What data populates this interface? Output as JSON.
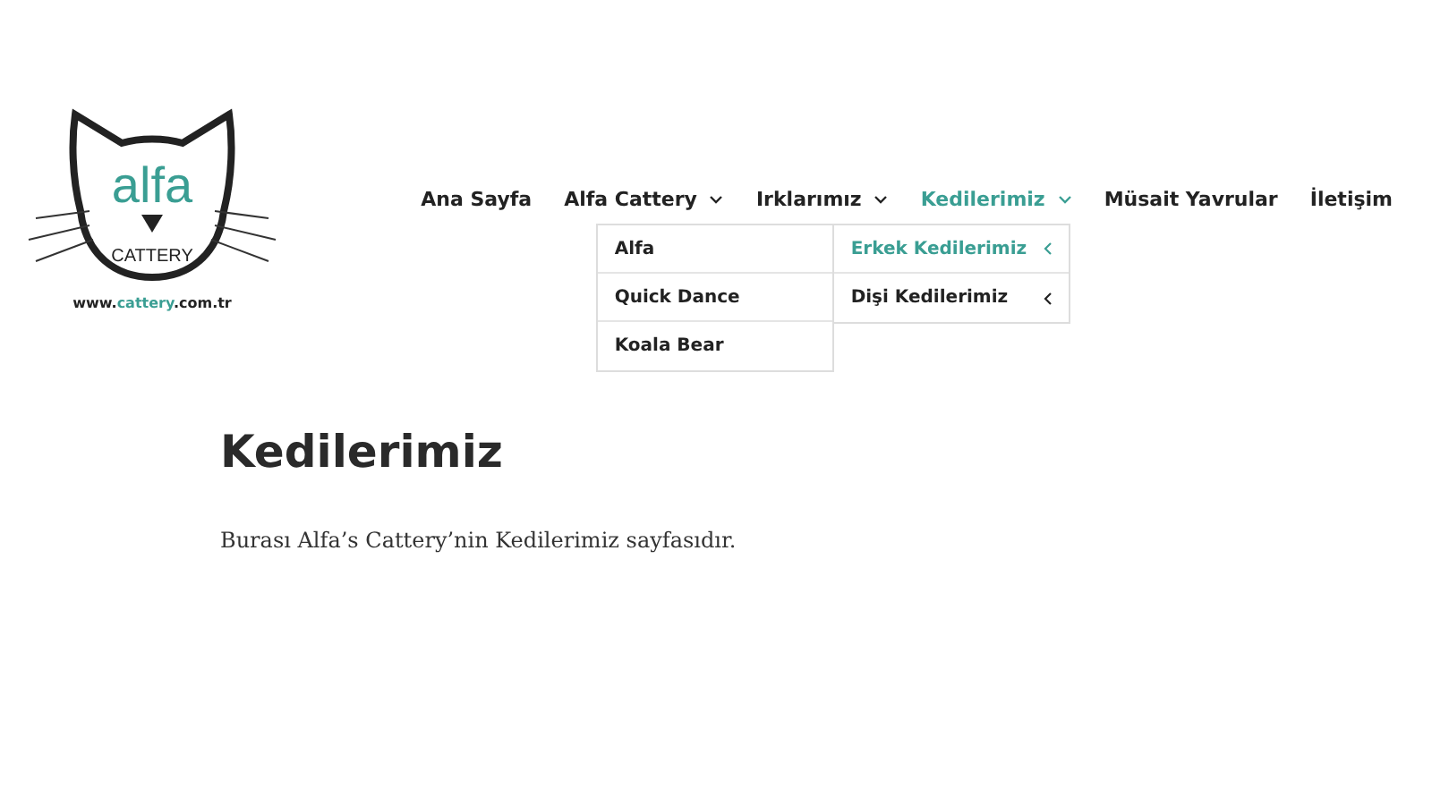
{
  "logo": {
    "name": "alfa",
    "subtitle": "CATTERY",
    "url_parts": [
      "www.",
      "cattery",
      ".com.tr"
    ]
  },
  "nav": [
    {
      "label": "Ana Sayfa",
      "has_submenu": false,
      "selected": false
    },
    {
      "label": "Alfa Cattery",
      "has_submenu": true,
      "selected": false
    },
    {
      "label": "Irklarımız",
      "has_submenu": true,
      "selected": false
    },
    {
      "label": "Kedilerimiz",
      "has_submenu": true,
      "selected": true
    },
    {
      "label": "Müsait Yavrular",
      "has_submenu": false,
      "selected": false
    },
    {
      "label": "İletişim",
      "has_submenu": false,
      "selected": false
    }
  ],
  "dropdown": {
    "column_1": [
      {
        "label": "Alfa",
        "selected": false
      },
      {
        "label": "Quick Dance",
        "selected": false
      },
      {
        "label": "Koala Bear",
        "selected": false
      }
    ],
    "column_2": [
      {
        "label": "Erkek Kedilerimiz",
        "selected": true
      },
      {
        "label": "Dişi Kedilerimiz",
        "selected": false
      }
    ]
  },
  "page": {
    "title": "Kedilerimiz",
    "text": "Burası Alfa’s Cattery’nin Kedilerimiz sayfasıdır."
  }
}
